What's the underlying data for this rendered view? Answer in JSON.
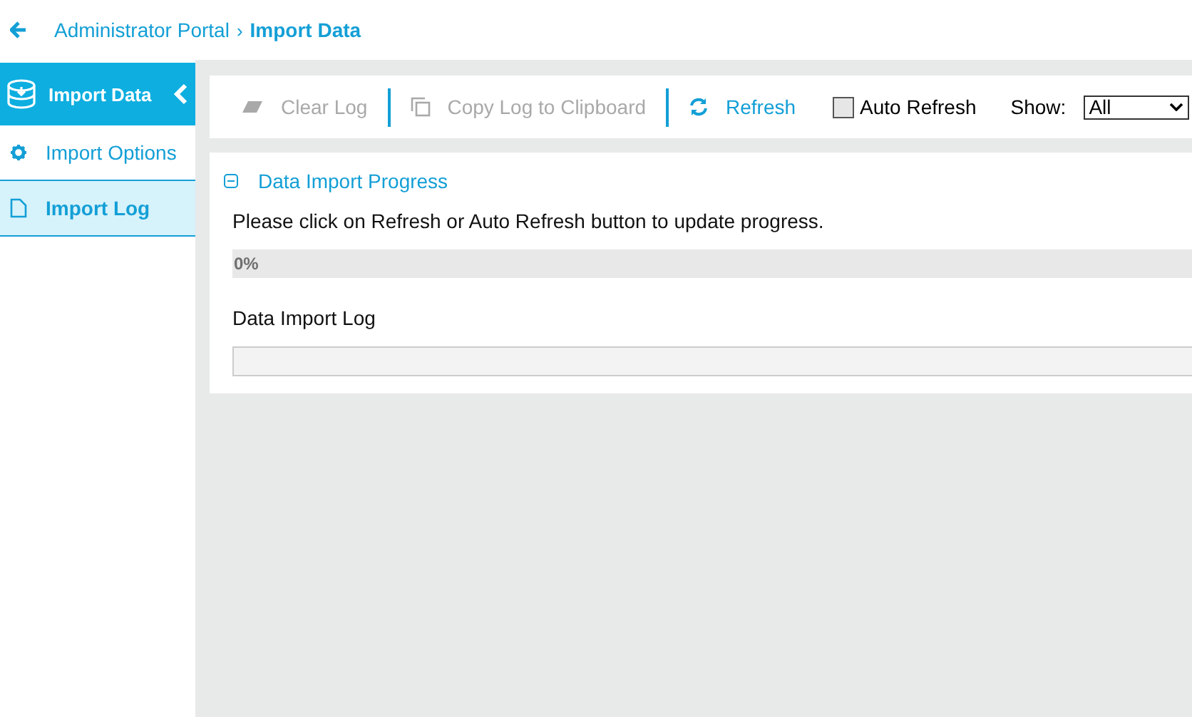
{
  "breadcrumb": {
    "parent": "Administrator Portal",
    "separator": "›",
    "current": "Import Data"
  },
  "sidebar": {
    "title": "Import Data",
    "items": [
      {
        "label": "Import Options",
        "kind": "gear",
        "selected": false
      },
      {
        "label": "Import Log",
        "kind": "document",
        "selected": true
      }
    ]
  },
  "toolbar": {
    "buttons": [
      {
        "label": "Clear Log",
        "kind": "eraser",
        "disabled": true
      },
      {
        "label": "Copy Log to Clipboard",
        "kind": "copy",
        "disabled": true
      },
      {
        "label": "Refresh",
        "kind": "refresh",
        "disabled": false
      }
    ],
    "auto_refresh": {
      "label": "Auto Refresh",
      "checked": false
    },
    "show": {
      "label": "Show:",
      "value": "All"
    }
  },
  "progress_section": {
    "title": "Data Import Progress",
    "expanded": true,
    "message": "Please click on Refresh or Auto Refresh button to update progress.",
    "progress": {
      "level": 0,
      "label": "0%"
    },
    "log_label": "Data Import Log"
  }
}
